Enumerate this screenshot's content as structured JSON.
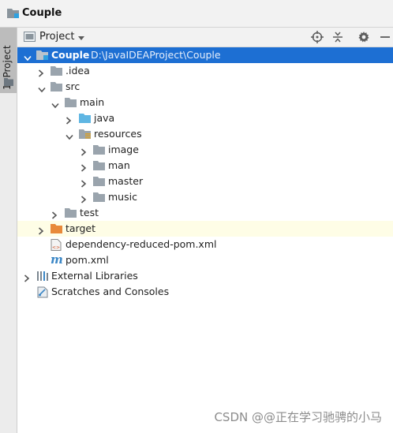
{
  "window": {
    "title": "Couple"
  },
  "side_tab": {
    "label": "1: Project"
  },
  "toolbar": {
    "view_label": "Project"
  },
  "tree": {
    "root": {
      "label": "Couple",
      "path": "D:\\JavaIDEAProject\\Couple"
    },
    "idea": "idea",
    "src": "src",
    "main": "main",
    "java": "java",
    "resources": "resources",
    "image": "image",
    "man": "man",
    "master": "master",
    "music": "music",
    "test": "test",
    "target": "target",
    "dep_pom": "dependency-reduced-pom.xml",
    "pom": "pom.xml",
    "ext_libs": "External Libraries",
    "scratches": "Scratches and Consoles"
  },
  "watermark": "CSDN @@正在学习驰骋的小马",
  "colors": {
    "selection": "#1d6fd3",
    "folder": "#9aa4ad",
    "source_folder": "#5fb6e3",
    "excluded_folder": "#e8893a",
    "highlight_row": "#fefde6"
  }
}
